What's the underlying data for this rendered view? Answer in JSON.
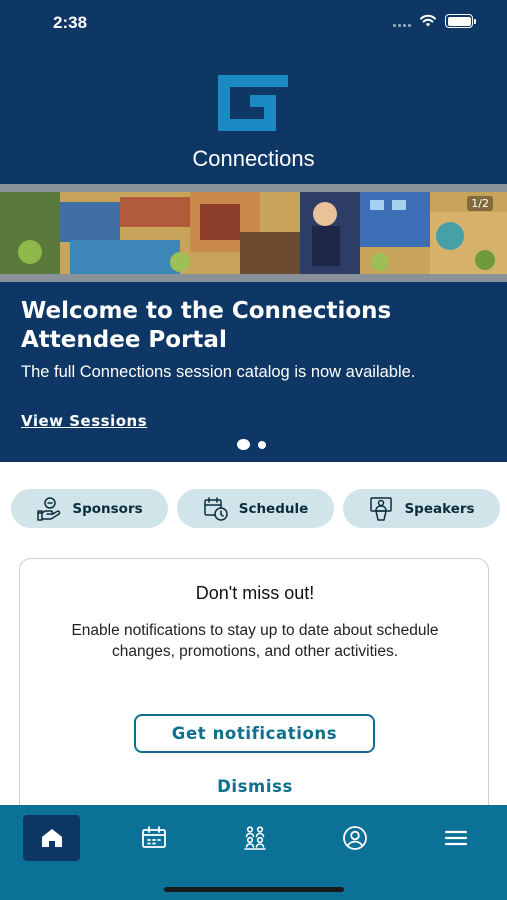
{
  "status_bar": {
    "time": "2:38"
  },
  "header": {
    "app_title": "Connections"
  },
  "banner": {
    "counter": "1/2"
  },
  "carousel": {
    "title": "Welcome to the Connections Attendee Portal",
    "text": "The full Connections session catalog is now available.",
    "link_label": "View Sessions",
    "slides_total": 2,
    "active_slide": 1
  },
  "quick_links": [
    {
      "label": "Sponsors",
      "icon": "sponsor-hand-icon"
    },
    {
      "label": "Schedule",
      "icon": "calendar-clock-icon"
    },
    {
      "label": "Speakers",
      "icon": "speaker-podium-icon"
    }
  ],
  "notification_card": {
    "title": "Don't miss out!",
    "text": "Enable notifications to stay up to date about schedule changes, promotions, and other activities.",
    "primary_label": "Get notifications",
    "secondary_label": "Dismiss"
  },
  "tab_bar": {
    "items": [
      {
        "icon": "home-icon",
        "active": true
      },
      {
        "icon": "calendar-icon",
        "active": false
      },
      {
        "icon": "people-icon",
        "active": false
      },
      {
        "icon": "profile-icon",
        "active": false
      },
      {
        "icon": "menu-icon",
        "active": false
      }
    ]
  },
  "colors": {
    "hero_background": "#0e3765",
    "accent": "#0f6f8e",
    "tab_bar": "#0c7197",
    "pill_background": "#d1e4ea"
  }
}
